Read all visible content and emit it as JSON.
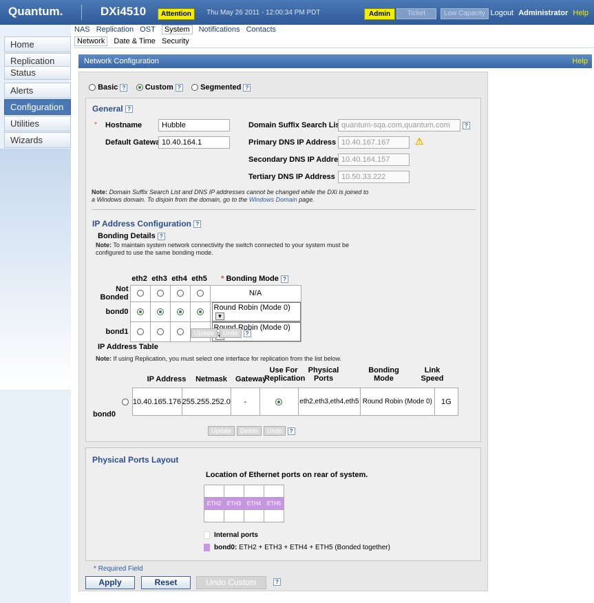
{
  "header": {
    "logo": "Quantum.",
    "model": "DXi4510",
    "attention": "Attention",
    "datetime": "Thu May 26 2011 - 12:00:34 PM PDT",
    "admin": "Admin",
    "ticket": "Ticket",
    "low_capacity": "Low Capacity",
    "logout": "Logout",
    "user": "Administrator",
    "help": "Help"
  },
  "sidebar": {
    "items": [
      {
        "label": "Home"
      },
      {
        "label": "Replication"
      },
      {
        "label": "Status"
      },
      {
        "label": "Alerts"
      },
      {
        "label": "Configuration"
      },
      {
        "label": "Utilities"
      },
      {
        "label": "Wizards"
      }
    ]
  },
  "tabs": {
    "primary": [
      "NAS",
      "Replication",
      "OST",
      "System",
      "Notifications",
      "Contacts"
    ],
    "secondary": [
      "Network",
      "Date & Time",
      "Security"
    ]
  },
  "page": {
    "title": "Network Configuration",
    "help": "Help"
  },
  "modes": {
    "basic": "Basic",
    "custom": "Custom",
    "segmented": "Segmented",
    "q": "?"
  },
  "general": {
    "title": "General",
    "hostname_label": "Hostname",
    "hostname": "Hubble",
    "gateway_label": "Default Gateway",
    "gateway": "10.40.164.1",
    "domain_label": "Domain Suffix Search List",
    "domain": "quantum-sqa.com,quantum.com",
    "pdns_label": "Primary DNS IP Address",
    "pdns": "10.40.167.167",
    "sdns_label": "Secondary DNS IP Address",
    "sdns": "10.40.164.157",
    "tdns_label": "Tertiary DNS IP Address",
    "tdns": "10.50.33.222",
    "note_b": "Note:",
    "note_1": " Domain Suffix Search List and DNS IP addresses cannot be changed while the DXi is joined to",
    "note_2": "a Windows domain. To disjoin from the domain, go to the ",
    "note_link": "Windows Domain",
    "note_3": " page."
  },
  "ipconf": {
    "title": "IP Address Configuration",
    "bonding_title": "Bonding Details",
    "bond_note_b": "Note:",
    "bond_note_1": " To maintain system network connectivity the switch connected to your system must be",
    "bond_note_2": "configured to use the same bonding mode.",
    "ports": [
      "eth2",
      "eth3",
      "eth4",
      "eth5"
    ],
    "bonding_mode": "Bonding Mode",
    "rows": [
      "Not Bonded",
      "bond0",
      "bond1"
    ],
    "na": "N/A",
    "mode_value": "Round Robin (Mode 0)",
    "update": "Update",
    "undo": "Undo"
  },
  "iptable": {
    "title": "IP Address Table",
    "note_b": "Note:",
    "note": " If using Replication, you must select one interface for replication from the list below.",
    "headers": [
      "IP Address",
      "Netmask",
      "Gateway",
      "Use For Replication",
      "Physical Ports",
      "Bonding Mode",
      "Link Speed"
    ],
    "row": {
      "name": "bond0",
      "ip": "10.40.165.176",
      "mask": "255.255.252.0",
      "gw": "-",
      "ports": "eth2,eth3,eth4,eth5",
      "mode": "Round Robin (Mode 0)",
      "speed": "1G"
    },
    "update": "Update",
    "delete": "Delete",
    "undo": "Undo"
  },
  "ports_layout": {
    "title": "Physical Ports Layout",
    "caption": "Location of Ethernet ports on rear of system.",
    "ports": [
      "ETH2",
      "ETH3",
      "ETH4",
      "ETH5"
    ],
    "legend_internal": "Internal ports",
    "legend_bond_b": "bond0:",
    "legend_bond": " ETH2 + ETH3 + ETH4 + ETH5 (Bonded together)",
    "bond_color": "#c895e6"
  },
  "footer": {
    "required": "* Required Field",
    "apply": "Apply",
    "reset": "Reset",
    "undo_custom": "Undo Custom"
  }
}
